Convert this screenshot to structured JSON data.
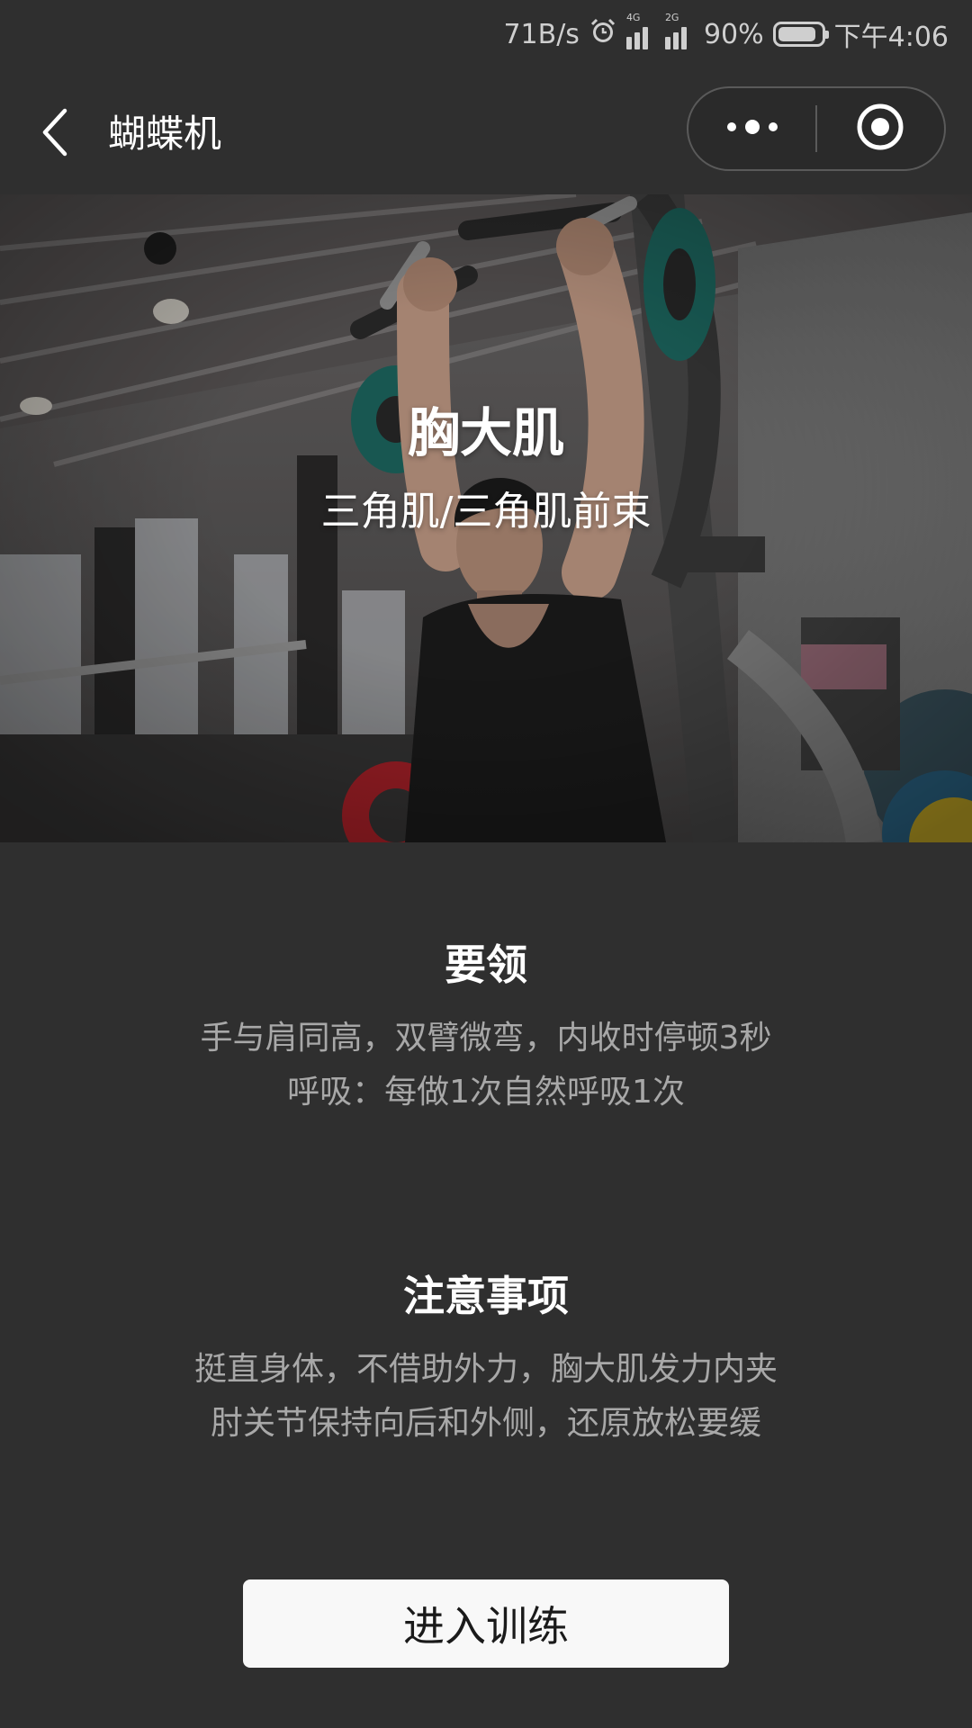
{
  "status_bar": {
    "net_speed": "71B/s",
    "sim1_net": "4G",
    "sim2_net": "2G",
    "battery_percent": "90%",
    "battery_level": 0.9,
    "time": "下午4:06"
  },
  "nav": {
    "title": "蝴蝶机"
  },
  "hero": {
    "title": "胸大肌",
    "subtitle": "三角肌/三角肌前束"
  },
  "tips": {
    "title": "要领",
    "lines": [
      "手与肩同高，双臂微弯，内收时停顿3秒",
      "呼吸：每做1次自然呼吸1次"
    ]
  },
  "notes": {
    "title": "注意事项",
    "lines": [
      "挺直身体，不借助外力，胸大肌发力内夹",
      "肘关节保持向后和外侧，还原放松要缓"
    ]
  },
  "start_button_label": "进入训练",
  "icons": {
    "back": "chevron-left-icon",
    "more": "more-dots-icon",
    "close": "record-target-icon",
    "alarm": "alarm-clock-icon"
  },
  "colors": {
    "background": "#2f2f2f",
    "text_primary": "#ffffff",
    "text_secondary": "#a8a8a8",
    "button_bg": "#f8f8f8",
    "button_text": "#1a1a1a"
  }
}
